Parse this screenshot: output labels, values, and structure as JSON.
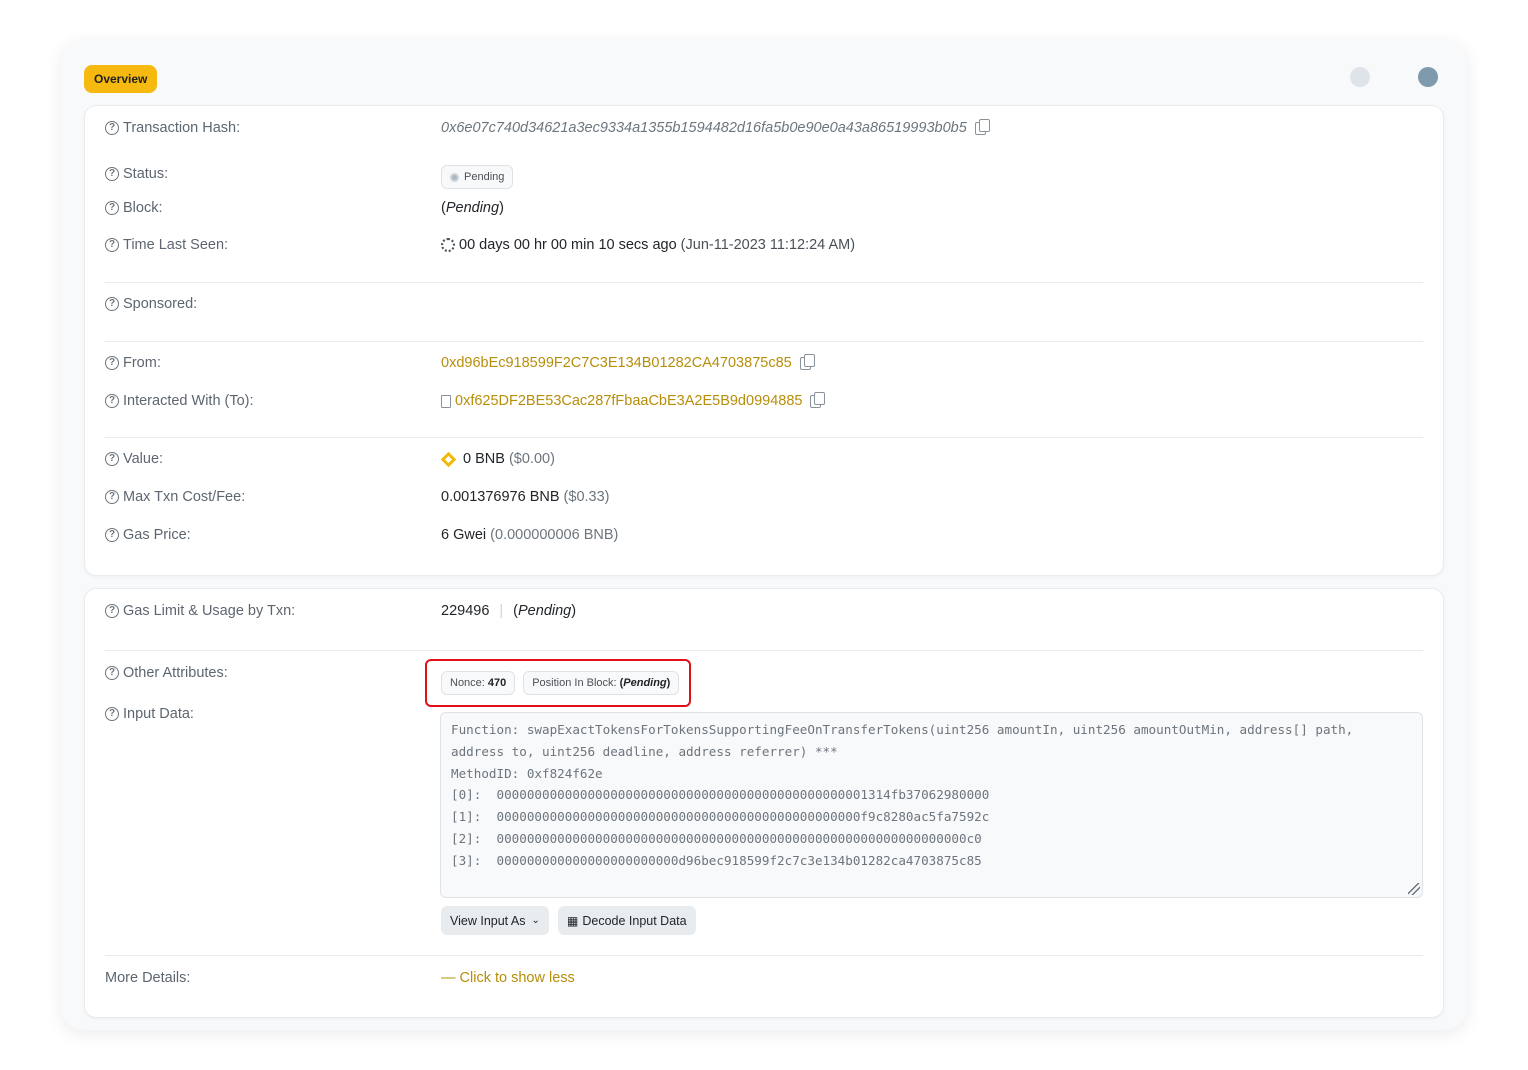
{
  "tab": {
    "label": "Overview"
  },
  "overview": {
    "tx_hash": {
      "label": "Transaction Hash:",
      "value": "0x6e07c740d34621a3ec9334a1355b1594482d16fa5b0e90e0a43a86519993b0b5"
    },
    "status": {
      "label": "Status:",
      "value": "Pending"
    },
    "block": {
      "label": "Block:",
      "open": "(",
      "value": "Pending",
      "close": ")"
    },
    "time_last_seen": {
      "label": "Time Last Seen:",
      "value": "00 days 00 hr 00 min 10 secs ago",
      "timestamp": "(Jun-11-2023 11:12:24 AM)"
    },
    "sponsored": {
      "label": "Sponsored:"
    },
    "from": {
      "label": "From:",
      "value": "0xd96bEc918599F2C7C3E134B01282CA4703875c85"
    },
    "to": {
      "label": "Interacted With (To):",
      "value": "0xf625DF2BE53Cac287fFbaaCbE3A2E5B9d0994885"
    },
    "value": {
      "label": "Value:",
      "amount": "0 BNB",
      "usd": "($0.00)"
    },
    "max_fee": {
      "label": "Max Txn Cost/Fee:",
      "amount": "0.001376976 BNB",
      "usd": "($0.33)"
    },
    "gas_price": {
      "label": "Gas Price:",
      "amount": "6 Gwei",
      "sub": "(0.000000006 BNB)"
    }
  },
  "details": {
    "gas_limit": {
      "label": "Gas Limit & Usage by Txn:",
      "value": "229496",
      "separator": "|",
      "open": "(",
      "usage": "Pending",
      "close": ")"
    },
    "other": {
      "label": "Other Attributes:",
      "nonce_label": "Nonce:",
      "nonce_value": "470",
      "position_label": "Position In Block:",
      "position_open": "(",
      "position_value": "Pending",
      "position_close": ")"
    },
    "input": {
      "label": "Input Data:",
      "lines": [
        "Function: swapExactTokensForTokensSupportingFeeOnTransferTokens(uint256 amountIn, uint256 amountOutMin, address[] path,",
        "address to, uint256 deadline, address referrer) ***",
        "",
        "MethodID: 0xf824f62e",
        "[0]:  0000000000000000000000000000000000000000000000001314fb37062980000",
        "[1]:  000000000000000000000000000000000000000000000000f9c8280ac5fa7592c",
        "[2]:  00000000000000000000000000000000000000000000000000000000000000c0",
        "[3]:  000000000000000000000000d96bec918599f2c7c3e134b01282ca4703875c85"
      ],
      "view_button": "View Input As",
      "decode_button": "Decode Input Data"
    },
    "more": {
      "label": "More Details:",
      "link": "— Click to show less"
    }
  }
}
